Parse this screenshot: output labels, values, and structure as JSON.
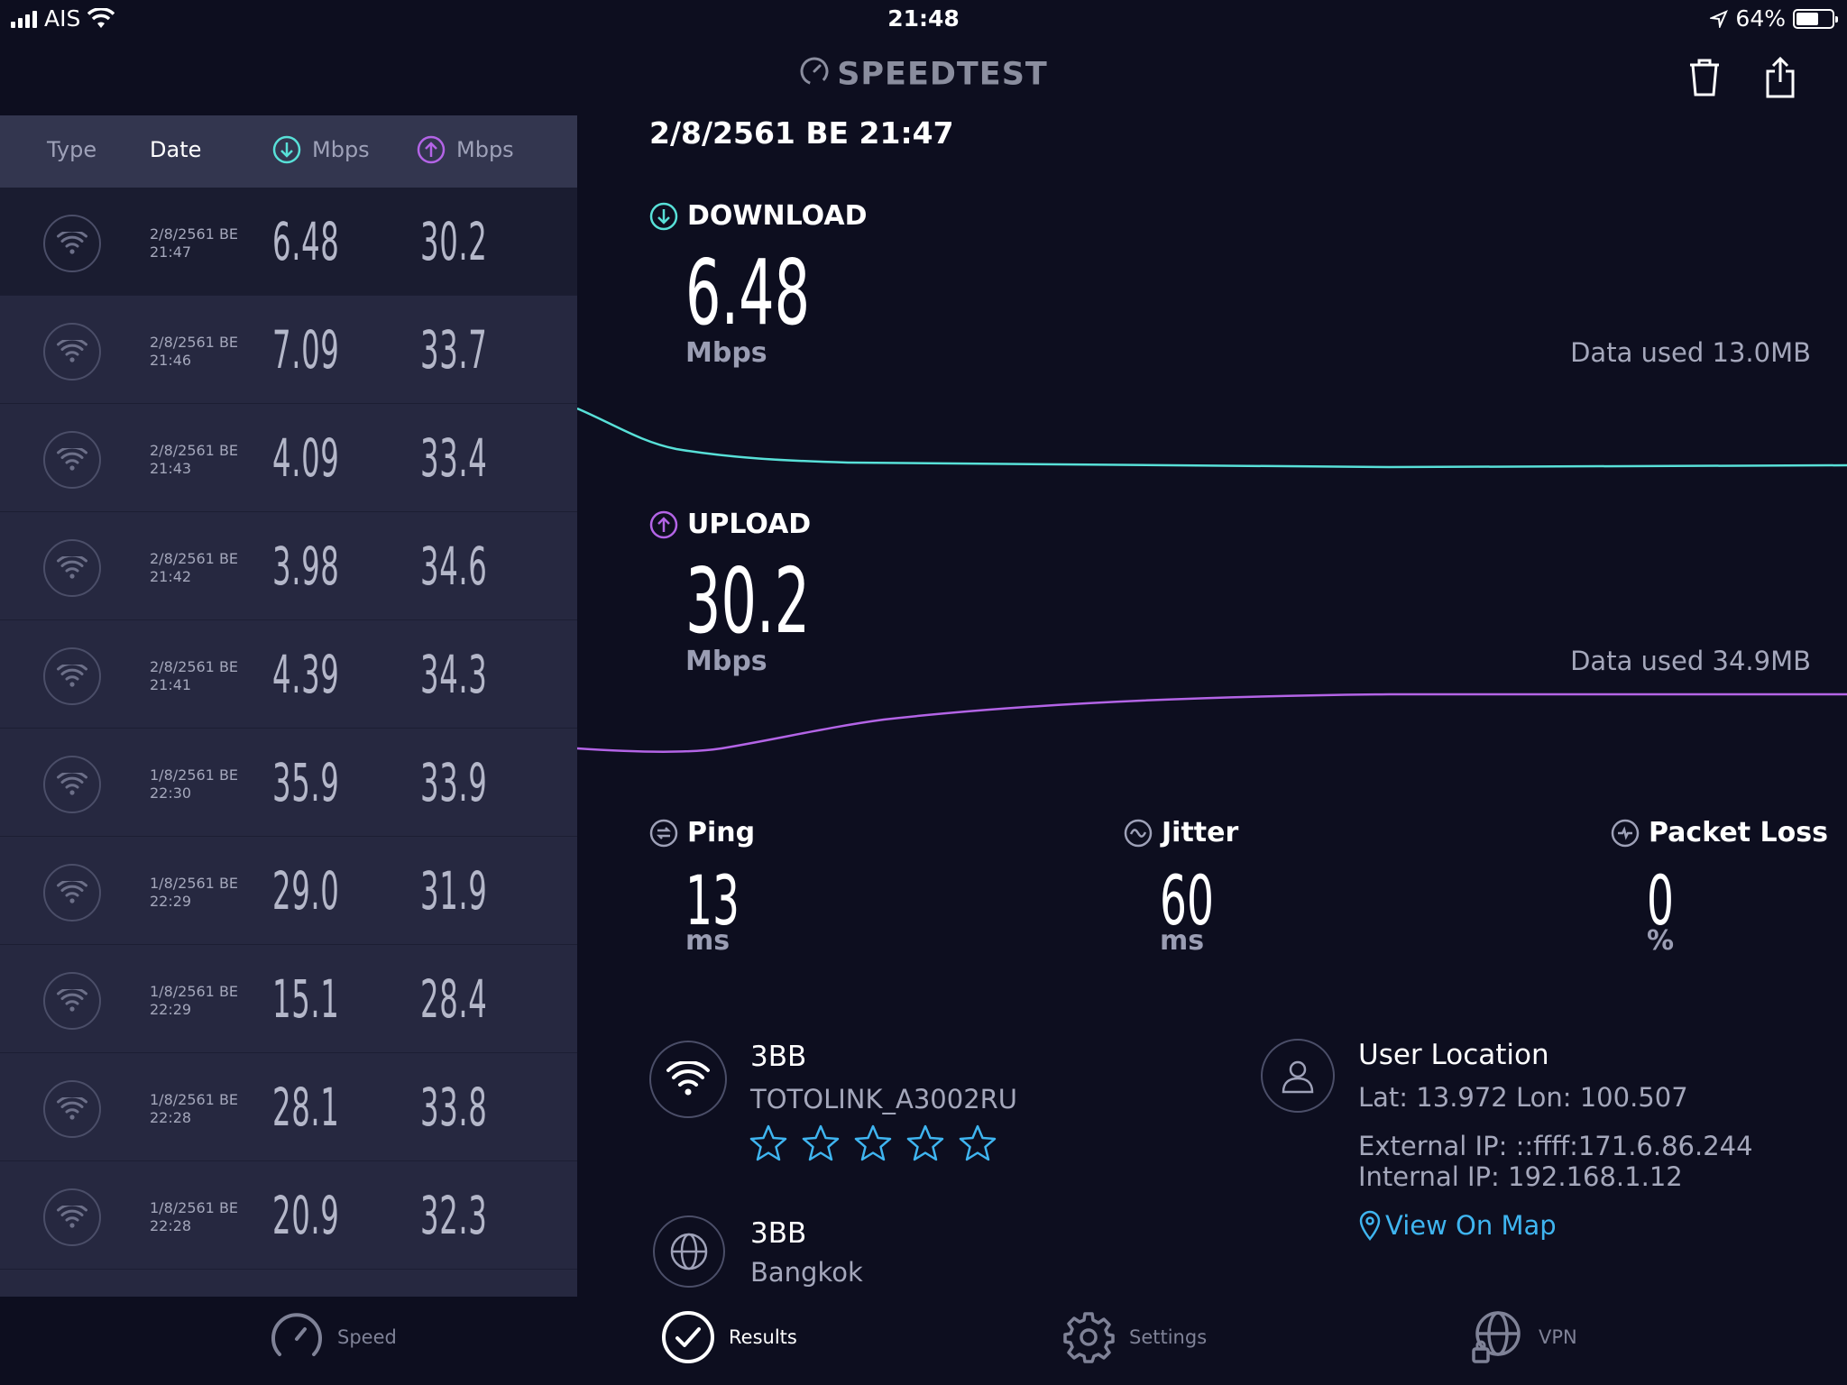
{
  "status_bar": {
    "carrier": "AIS",
    "time": "21:48",
    "battery": "64%"
  },
  "app": {
    "title": "SPEEDTEST"
  },
  "history": {
    "columns": {
      "type": "Type",
      "date": "Date",
      "download": "Mbps",
      "upload": "Mbps"
    },
    "rows": [
      {
        "date1": "2/8/2561 BE",
        "date2": "21:47",
        "download": "6.48",
        "upload": "30.2"
      },
      {
        "date1": "2/8/2561 BE",
        "date2": "21:46",
        "download": "7.09",
        "upload": "33.7"
      },
      {
        "date1": "2/8/2561 BE",
        "date2": "21:43",
        "download": "4.09",
        "upload": "33.4"
      },
      {
        "date1": "2/8/2561 BE",
        "date2": "21:42",
        "download": "3.98",
        "upload": "34.6"
      },
      {
        "date1": "2/8/2561 BE",
        "date2": "21:41",
        "download": "4.39",
        "upload": "34.3"
      },
      {
        "date1": "1/8/2561 BE",
        "date2": "22:30",
        "download": "35.9",
        "upload": "33.9"
      },
      {
        "date1": "1/8/2561 BE",
        "date2": "22:29",
        "download": "29.0",
        "upload": "31.9"
      },
      {
        "date1": "1/8/2561 BE",
        "date2": "22:29",
        "download": "15.1",
        "upload": "28.4"
      },
      {
        "date1": "1/8/2561 BE",
        "date2": "22:28",
        "download": "28.1",
        "upload": "33.8"
      },
      {
        "date1": "1/8/2561 BE",
        "date2": "22:28",
        "download": "20.9",
        "upload": "32.3"
      }
    ]
  },
  "result": {
    "datetime": "2/8/2561 BE 21:47",
    "download": {
      "label": "DOWNLOAD",
      "value": "6.48",
      "unit": "Mbps",
      "data_used": "Data used 13.0MB"
    },
    "upload": {
      "label": "UPLOAD",
      "value": "30.2",
      "unit": "Mbps",
      "data_used": "Data used 34.9MB"
    },
    "ping": {
      "label": "Ping",
      "value": "13",
      "unit": "ms"
    },
    "jitter": {
      "label": "Jitter",
      "value": "60",
      "unit": "ms"
    },
    "packet_loss": {
      "label": "Packet Loss",
      "value": "0",
      "unit": "%"
    },
    "isp": {
      "name": "3BB",
      "network": "TOTOLINK_A3002RU",
      "rating": 5
    },
    "server": {
      "name": "3BB",
      "city": "Bangkok"
    },
    "location": {
      "title": "User Location",
      "coords": "Lat: 13.972  Lon: 100.507",
      "external_ip": "External IP: ::ffff:171.6.86.244",
      "internal_ip": "Internal IP: 192.168.1.12",
      "map_link": "View On Map"
    }
  },
  "tabs": [
    {
      "label": "Speed"
    },
    {
      "label": "Results"
    },
    {
      "label": "Settings"
    },
    {
      "label": "VPN"
    }
  ],
  "colors": {
    "download": "#58e0d8",
    "upload": "#b364e6",
    "link": "#3fb5f0",
    "background": "#0d0e1f",
    "panel": "#262840"
  }
}
